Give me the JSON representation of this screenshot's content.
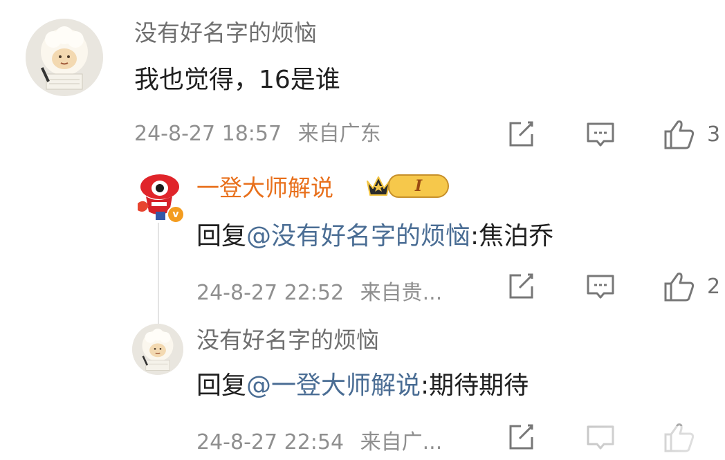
{
  "comments": [
    {
      "username": "没有好名字的烦恼",
      "text": "我也觉得，16是谁",
      "time": "24-8-27 18:57",
      "location": "来自广东",
      "like_count": "3"
    }
  ],
  "replies": [
    {
      "username": "一登大师解说",
      "badge_level": "I",
      "reply_prefix": "回复",
      "mention": "@没有好名字的烦恼",
      "text": ":焦泊乔",
      "time": "24-8-27 22:52",
      "location": "来自贵...",
      "like_count": "2"
    },
    {
      "username": "没有好名字的烦恼",
      "reply_prefix": "回复",
      "mention": "@一登大师解说",
      "text": ":期待期待",
      "time": "24-8-27 22:54",
      "location": "来自广...",
      "like_count": ""
    }
  ],
  "icons": {
    "share": "share-icon",
    "comment": "comment-icon",
    "like": "thumbs-up-icon"
  },
  "colors": {
    "mention": "#4a6d94",
    "vip_username": "#e8701c",
    "meta": "#8f8f8f"
  }
}
